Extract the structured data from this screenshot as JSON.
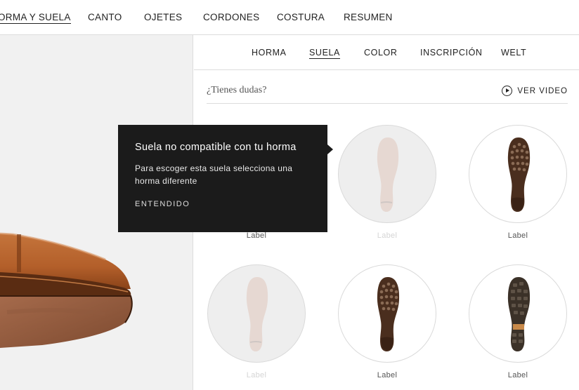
{
  "top_nav": {
    "items": [
      "ORMA Y SUELA",
      "CANTO",
      "OJETES",
      "CORDONES",
      "COSTURA",
      "RESUMEN"
    ],
    "active_index": 0
  },
  "sub_nav": {
    "items": [
      "HORMA",
      "SUELA",
      "COLOR",
      "INSCRIPCIÓN",
      "WELT"
    ],
    "active_index": 1
  },
  "help": {
    "question": "¿Tienes dudas?",
    "video_label": "VER VIDEO",
    "video_icon": "play-circle-icon"
  },
  "options": [
    {
      "label": "Label",
      "state": "selected-behind-tooltip",
      "sole": "dark-brown-studded"
    },
    {
      "label": "Label",
      "state": "disabled",
      "sole": "leather-light"
    },
    {
      "label": "Label",
      "state": "available",
      "sole": "dark-brown-studded"
    },
    {
      "label": "Label",
      "state": "disabled",
      "sole": "leather-light"
    },
    {
      "label": "Label",
      "state": "available",
      "sole": "dark-brown-studded"
    },
    {
      "label": "Label",
      "state": "available",
      "sole": "commando-lug"
    }
  ],
  "tooltip": {
    "title": "Suela no compatible con tu horma",
    "body": "Para escoger esta suela selecciona una horma diferente",
    "button": "ENTENDIDO"
  },
  "colors": {
    "accent": "#222222",
    "tooltip_bg": "#1b1b1b",
    "preview_bg": "#f1f1f1",
    "shoe_leather": "#b8652f",
    "sole_dark": "#4a2e1e"
  }
}
